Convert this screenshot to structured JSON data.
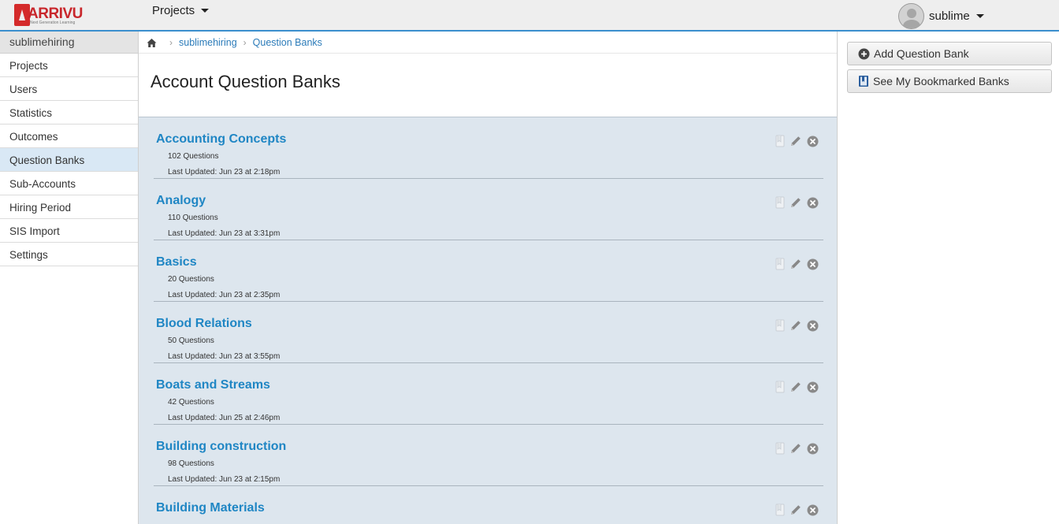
{
  "header": {
    "logo_text": "ARRIVU",
    "logo_tagline": "Next Generation Learning",
    "projects_label": "Projects",
    "user_name": "sublime"
  },
  "sidebar": {
    "account_name": "sublimehiring",
    "items": [
      {
        "label": "Projects"
      },
      {
        "label": "Users"
      },
      {
        "label": "Statistics"
      },
      {
        "label": "Outcomes"
      },
      {
        "label": "Question Banks"
      },
      {
        "label": "Sub-Accounts"
      },
      {
        "label": "Hiring Period"
      },
      {
        "label": "SIS Import"
      },
      {
        "label": "Settings"
      }
    ]
  },
  "breadcrumb": {
    "items": [
      {
        "label": "sublimehiring"
      },
      {
        "label": "Question Banks"
      }
    ]
  },
  "main": {
    "title": "Account Question Banks",
    "banks": [
      {
        "title": "Accounting Concepts",
        "count": "102 Questions",
        "updated": "Last Updated: Jun 23 at 2:18pm"
      },
      {
        "title": "Analogy",
        "count": "110 Questions",
        "updated": "Last Updated: Jun 23 at 3:31pm"
      },
      {
        "title": "Basics",
        "count": "20 Questions",
        "updated": "Last Updated: Jun 23 at 2:35pm"
      },
      {
        "title": "Blood Relations",
        "count": "50 Questions",
        "updated": "Last Updated: Jun 23 at 3:55pm"
      },
      {
        "title": "Boats and Streams",
        "count": "42 Questions",
        "updated": "Last Updated: Jun 25 at 2:46pm"
      },
      {
        "title": "Building construction",
        "count": "98 Questions",
        "updated": "Last Updated: Jun 23 at 2:15pm"
      },
      {
        "title": "Building Materials",
        "count": "",
        "updated": ""
      }
    ]
  },
  "right_panel": {
    "add_bank_label": "Add Question Bank",
    "bookmarked_label": "See My Bookmarked Banks"
  },
  "colors": {
    "accent": "#3b8fce",
    "link": "#1f86c4",
    "list_bg": "#dde6ee",
    "active_nav": "#d9e8f5",
    "logo_red": "#c8262b"
  }
}
